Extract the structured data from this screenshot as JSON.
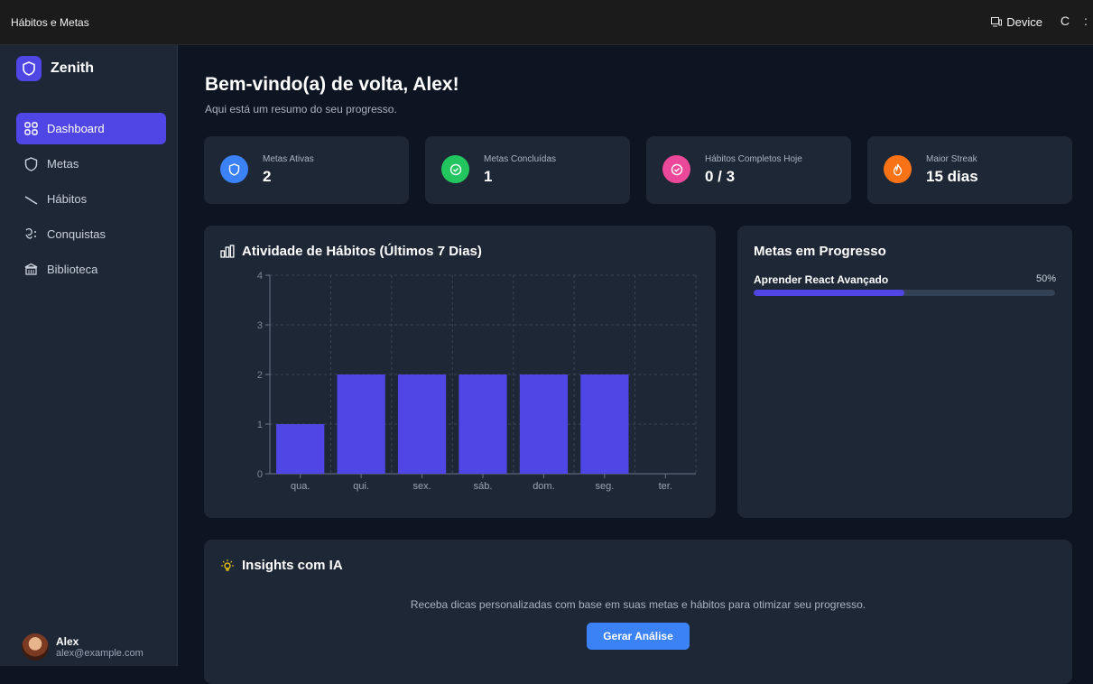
{
  "window": {
    "title": "Hábitos e Metas",
    "device_label": "Device",
    "reload_glyph": "C",
    "more_glyph": ":"
  },
  "brand": {
    "name": "Zenith"
  },
  "nav": [
    {
      "label": "Dashboard",
      "icon": "grid-icon",
      "active": true
    },
    {
      "label": "Metas",
      "icon": "shield-icon",
      "active": false
    },
    {
      "label": "Hábitos",
      "icon": "trend-icon",
      "active": false
    },
    {
      "label": "Conquistas",
      "icon": "trophy-icon",
      "active": false
    },
    {
      "label": "Biblioteca",
      "icon": "library-icon",
      "active": false
    }
  ],
  "user": {
    "name": "Alex",
    "email": "alex@example.com"
  },
  "header": {
    "title": "Bem-vindo(a) de volta, Alex!",
    "subtitle": "Aqui está um resumo do seu progresso."
  },
  "stats": [
    {
      "label": "Metas Ativas",
      "value": "2",
      "icon": "shield-icon",
      "color": "#3b82f6"
    },
    {
      "label": "Metas Concluídas",
      "value": "1",
      "icon": "check-circle-icon",
      "color": "#22c55e"
    },
    {
      "label": "Hábitos Completos Hoje",
      "value": "0 / 3",
      "icon": "check-circle-icon",
      "color": "#ec4899"
    },
    {
      "label": "Maior Streak",
      "value": "15 dias",
      "icon": "flame-icon",
      "color": "#f97316"
    }
  ],
  "activity": {
    "title": "Atividade de Hábitos (Últimos 7 Dias)"
  },
  "chart_data": {
    "type": "bar",
    "categories": [
      "qua.",
      "qui.",
      "sex.",
      "sáb.",
      "dom.",
      "seg.",
      "ter."
    ],
    "values": [
      1,
      2,
      2,
      2,
      2,
      2,
      0
    ],
    "ylim": [
      0,
      4
    ],
    "yticks": [
      0,
      1,
      2,
      3,
      4
    ],
    "grid": true,
    "bar_color": "#4f46e5"
  },
  "goals": {
    "title": "Metas em Progresso",
    "items": [
      {
        "name": "Aprender React Avançado",
        "percent_label": "50%",
        "progress": 0.5
      }
    ]
  },
  "insights": {
    "title": "Insights com IA",
    "text": "Receba dicas personalizadas com base em suas metas e hábitos para otimizar seu progresso.",
    "button": "Gerar Análise"
  },
  "colors": {
    "accent": "#4f46e5",
    "button": "#3b82f6",
    "panel": "#1e2736",
    "background": "#0d1422"
  }
}
